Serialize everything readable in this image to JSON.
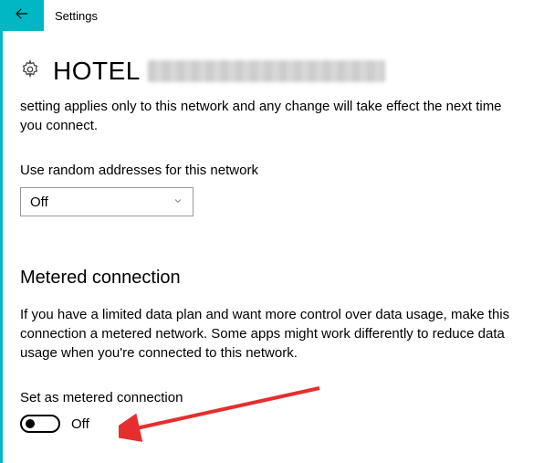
{
  "header": {
    "title": "Settings"
  },
  "network": {
    "name": "HOTEL",
    "description": "setting applies only to this network and any change will take effect the next time you connect."
  },
  "random_addresses": {
    "label": "Use random addresses for this network",
    "value": "Off"
  },
  "metered": {
    "heading": "Metered connection",
    "description": "If you have a limited data plan and want more control over data usage, make this connection a metered network. Some apps might work differently to reduce data usage when you're connected to this network.",
    "toggle_label": "Set as metered connection",
    "toggle_value": "Off"
  },
  "colors": {
    "accent": "#e62e2e"
  }
}
